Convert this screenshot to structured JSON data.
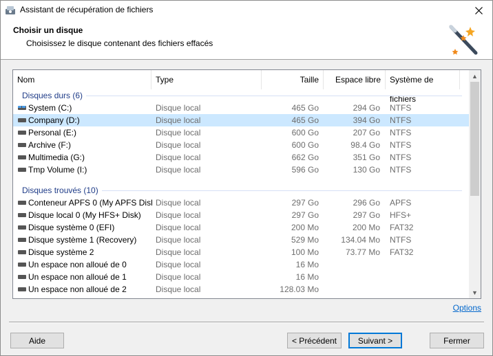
{
  "window": {
    "title": "Assistant de récupération de fichiers"
  },
  "header": {
    "title": "Choisir un disque",
    "subtitle": "Choisissez le disque contenant des fichiers effacés"
  },
  "columns": {
    "name": "Nom",
    "type": "Type",
    "size": "Taille",
    "free": "Espace libre",
    "fs": "Système de fichiers"
  },
  "groups": [
    {
      "label": "Disques durs (6)",
      "rows": [
        {
          "name": "System (C:)",
          "type": "Disque local",
          "size": "465 Go",
          "free": "294 Go",
          "fs": "NTFS",
          "icon": "windows-drive-icon",
          "selected": false
        },
        {
          "name": "Company (D:)",
          "type": "Disque local",
          "size": "465 Go",
          "free": "394 Go",
          "fs": "NTFS",
          "icon": "drive-icon",
          "selected": true
        },
        {
          "name": "Personal (E:)",
          "type": "Disque local",
          "size": "600 Go",
          "free": "207 Go",
          "fs": "NTFS",
          "icon": "drive-icon",
          "selected": false
        },
        {
          "name": "Archive (F:)",
          "type": "Disque local",
          "size": "600 Go",
          "free": "98.4 Go",
          "fs": "NTFS",
          "icon": "drive-icon",
          "selected": false
        },
        {
          "name": "Multimedia (G:)",
          "type": "Disque local",
          "size": "662 Go",
          "free": "351 Go",
          "fs": "NTFS",
          "icon": "drive-icon",
          "selected": false
        },
        {
          "name": "Tmp Volume (I:)",
          "type": "Disque local",
          "size": "596 Go",
          "free": "130 Go",
          "fs": "NTFS",
          "icon": "drive-icon",
          "selected": false
        }
      ]
    },
    {
      "label": "Disques trouvés (10)",
      "rows": [
        {
          "name": "Conteneur APFS 0 (My APFS Disk)",
          "type": "Disque local",
          "size": "297 Go",
          "free": "296 Go",
          "fs": "APFS",
          "icon": "drive-icon",
          "selected": false
        },
        {
          "name": "Disque local 0 (My HFS+ Disk)",
          "type": "Disque local",
          "size": "297 Go",
          "free": "297 Go",
          "fs": "HFS+",
          "icon": "drive-icon",
          "selected": false
        },
        {
          "name": "Disque système 0 (EFI)",
          "type": "Disque local",
          "size": "200 Mo",
          "free": "200 Mo",
          "fs": "FAT32",
          "icon": "drive-icon",
          "selected": false
        },
        {
          "name": "Disque système 1 (Recovery)",
          "type": "Disque local",
          "size": "529 Mo",
          "free": "134.04 Mo",
          "fs": "NTFS",
          "icon": "drive-icon",
          "selected": false
        },
        {
          "name": "Disque système 2",
          "type": "Disque local",
          "size": "100 Mo",
          "free": "73.77 Mo",
          "fs": "FAT32",
          "icon": "drive-icon",
          "selected": false
        },
        {
          "name": "Un espace non alloué de 0",
          "type": "Disque local",
          "size": "16 Mo",
          "free": "",
          "fs": "",
          "icon": "drive-icon",
          "selected": false
        },
        {
          "name": "Un espace non alloué de 1",
          "type": "Disque local",
          "size": "16 Mo",
          "free": "",
          "fs": "",
          "icon": "drive-icon",
          "selected": false
        },
        {
          "name": "Un espace non alloué de 2",
          "type": "Disque local",
          "size": "128.03 Mo",
          "free": "",
          "fs": "",
          "icon": "drive-icon",
          "selected": false
        }
      ]
    }
  ],
  "links": {
    "options": "Options"
  },
  "buttons": {
    "help": "Aide",
    "previous": "< Précédent",
    "next": "Suivant >",
    "close": "Fermer"
  },
  "colors": {
    "selection": "#cce8ff",
    "group_text": "#1f3c88",
    "link": "#0066cc",
    "accent": "#0078d7"
  }
}
